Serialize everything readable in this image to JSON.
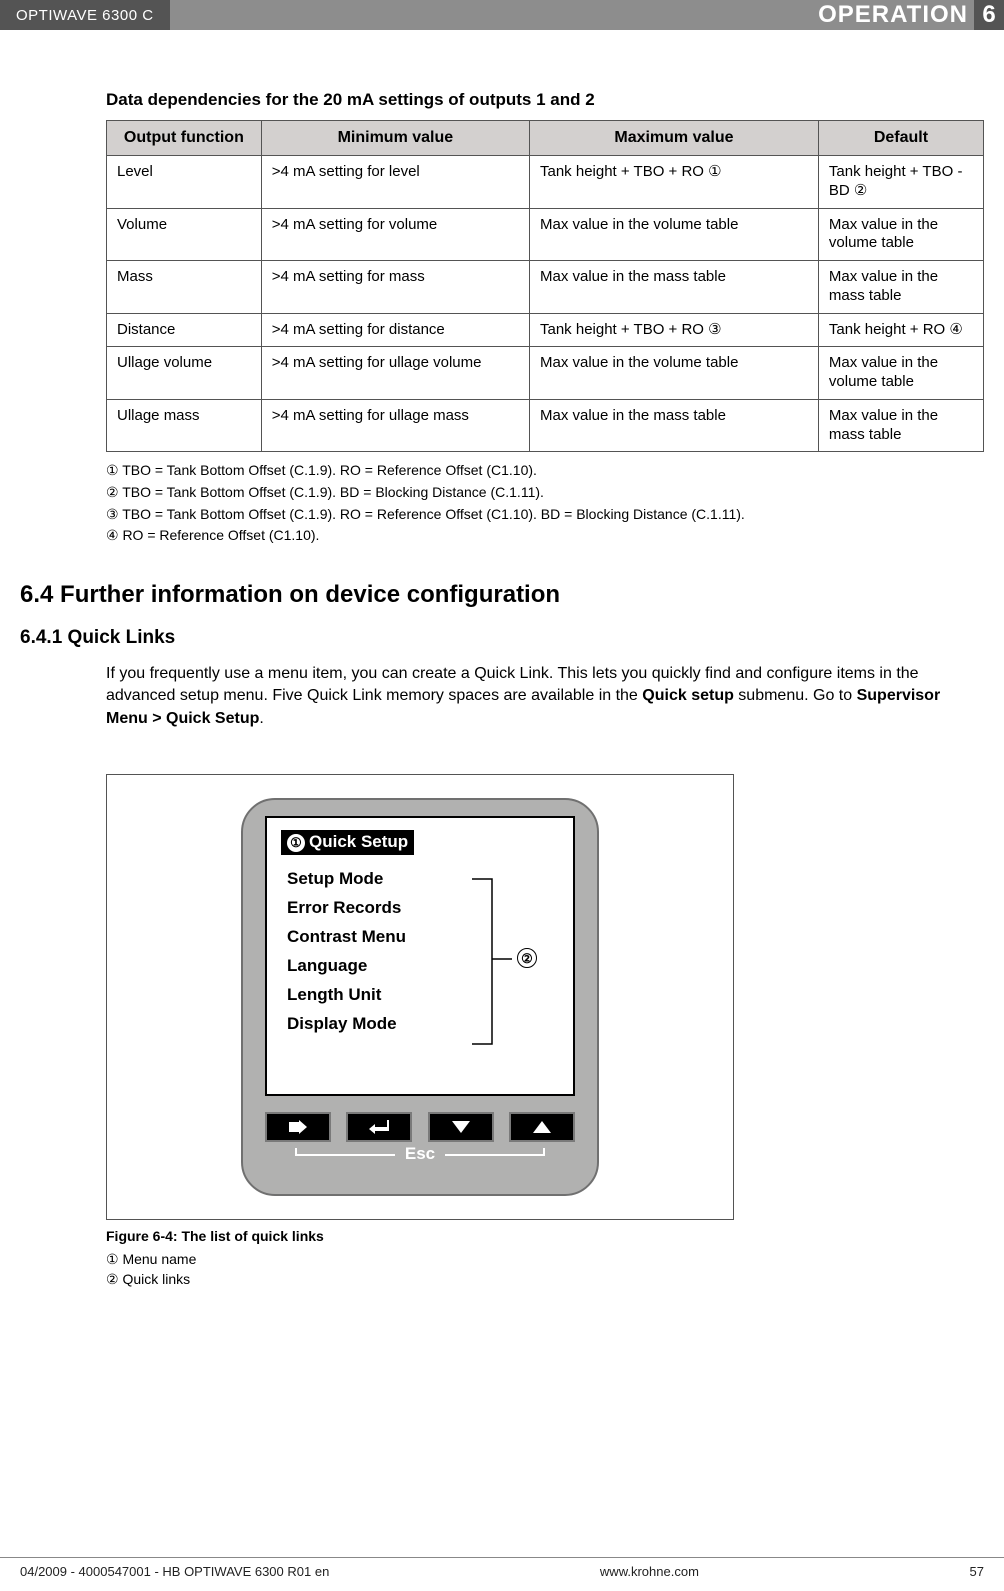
{
  "header": {
    "product": "OPTIWAVE 6300 C",
    "section": "OPERATION",
    "chapter_num": "6"
  },
  "table": {
    "title": "Data dependencies for the 20 mA settings of outputs 1 and 2",
    "headers": [
      "Output function",
      "Minimum value",
      "Maximum value",
      "Default"
    ],
    "rows": [
      {
        "fn": "Level",
        "min": ">4 mA setting for level",
        "max": "Tank height + TBO + RO  ①",
        "def": "Tank height + TBO - BD  ②"
      },
      {
        "fn": "Volume",
        "min": ">4 mA setting for volume",
        "max": "Max value in the volume table",
        "def": "Max value in the volume table"
      },
      {
        "fn": "Mass",
        "min": ">4 mA setting for mass",
        "max": "Max value in the mass table",
        "def": "Max value in the mass table"
      },
      {
        "fn": "Distance",
        "min": ">4 mA setting for distance",
        "max": "Tank height + TBO + RO  ③",
        "def": "Tank height + RO ④"
      },
      {
        "fn": "Ullage volume",
        "min": ">4 mA setting for ullage volume",
        "max": "Max value in the volume table",
        "def": "Max value in the volume table"
      },
      {
        "fn": "Ullage mass",
        "min": ">4 mA setting for ullage mass",
        "max": "Max value in the mass table",
        "def": "Max value in the mass table"
      }
    ],
    "footnotes": [
      "①  TBO = Tank Bottom Offset (C.1.9). RO =  Reference Offset (C1.10).",
      "②  TBO = Tank Bottom Offset (C.1.9). BD = Blocking Distance (C.1.11).",
      "③  TBO = Tank Bottom Offset (C.1.9). RO =  Reference Offset (C1.10). BD = Blocking Distance (C.1.11).",
      "④  RO =  Reference Offset (C1.10)."
    ]
  },
  "section_heading_1": "6.4  Further information on device configuration",
  "section_heading_2": "6.4.1  Quick Links",
  "body": {
    "p1a": "If you frequently use a menu item, you can create a Quick Link. This lets you  quickly find and configure items in the advanced setup menu. Five Quick Link memory spaces are available in the ",
    "p1b": "Quick setup",
    "p1c": " submenu. Go to ",
    "p1d": "Supervisor Menu > Quick Setup",
    "p1e": "."
  },
  "figure": {
    "title_marker": "①",
    "title": "Quick Setup",
    "items": [
      "Setup Mode",
      "Error Records",
      "Contrast Menu",
      "Language",
      "Length Unit",
      "Display Mode"
    ],
    "side_marker": "②",
    "esc": "Esc",
    "caption": "Figure 6-4: The list of quick links",
    "notes": [
      "①   Menu name",
      "②   Quick links"
    ]
  },
  "footer": {
    "left": "04/2009 - 4000547001 - HB OPTIWAVE 6300 R01 en",
    "center": "www.krohne.com",
    "right": "57"
  }
}
